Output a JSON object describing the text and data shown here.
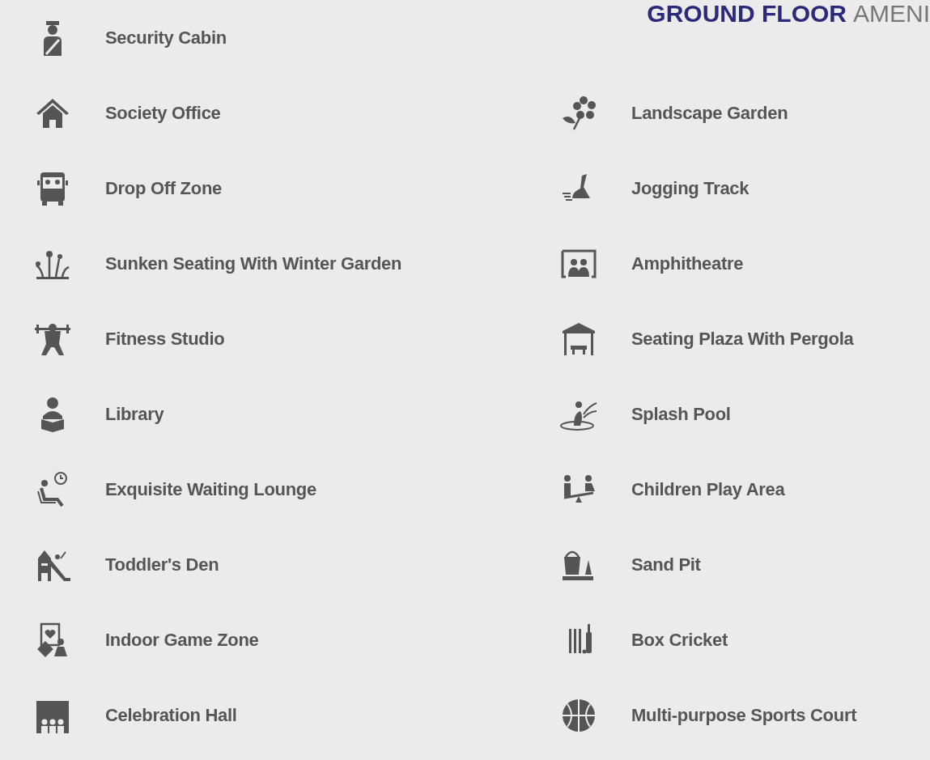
{
  "title": {
    "strong": "GROUND FLOOR",
    "light": "AMENI"
  },
  "left": [
    {
      "label": "Security Cabin",
      "kind": "guard"
    },
    {
      "label": "Society Office",
      "kind": "house"
    },
    {
      "label": "Drop Off Zone",
      "kind": "bus"
    },
    {
      "label": "Sunken Seating With Winter Garden",
      "kind": "plants"
    },
    {
      "label": "Fitness Studio",
      "kind": "lifter"
    },
    {
      "label": "Library",
      "kind": "reader"
    },
    {
      "label": "Exquisite Waiting Lounge",
      "kind": "lounger"
    },
    {
      "label": "Toddler's Den",
      "kind": "slide"
    },
    {
      "label": "Indoor Game Zone",
      "kind": "games"
    },
    {
      "label": "Celebration Hall",
      "kind": "stage"
    }
  ],
  "right": [
    {
      "label": "Landscape Garden",
      "kind": "flower"
    },
    {
      "label": "Jogging Track",
      "kind": "shoe"
    },
    {
      "label": "Amphitheatre",
      "kind": "audience"
    },
    {
      "label": "Seating Plaza With Pergola",
      "kind": "pergola"
    },
    {
      "label": "Splash Pool",
      "kind": "splash"
    },
    {
      "label": "Children Play Area",
      "kind": "seesaw"
    },
    {
      "label": "Sand Pit",
      "kind": "bucket"
    },
    {
      "label": "Box Cricket",
      "kind": "cricket"
    },
    {
      "label": "Multi-purpose Sports Court",
      "kind": "ball"
    }
  ]
}
